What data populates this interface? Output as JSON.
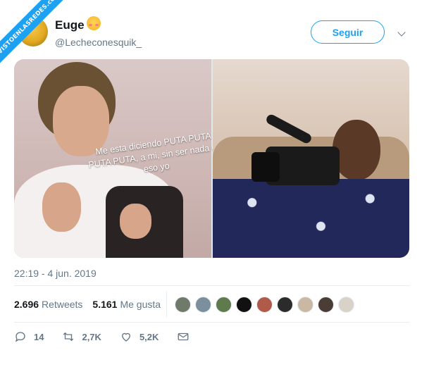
{
  "watermark": "VISTOENLASREDES.com",
  "tweet": {
    "display_name": "Euge",
    "handle": "@Lecheconesquik_",
    "follow_label": "Seguir",
    "meme_text": "Me esta diciendo PUTA PUTA PUTA PUTA, a mi, sin ser nada de eso yo",
    "timestamp": "22:19 - 4 jun. 2019"
  },
  "stats": {
    "retweets_count": "2.696",
    "retweets_label": "Retweets",
    "likes_count": "5.161",
    "likes_label": "Me gusta"
  },
  "likers": [
    {
      "color": "#6f7a6a"
    },
    {
      "color": "#7c8f9c"
    },
    {
      "color": "#5f7a4c"
    },
    {
      "color": "#111111"
    },
    {
      "color": "#b05a4a"
    },
    {
      "color": "#2b2b2b"
    },
    {
      "color": "#c9b9a4"
    },
    {
      "color": "#4a3d36"
    },
    {
      "color": "#d8d2c8"
    }
  ],
  "actions": {
    "reply_count": "14",
    "retweet_count": "2,7K",
    "like_count": "5,2K"
  },
  "colors": {
    "accent": "#1da1f2",
    "secondary_text": "#657786"
  }
}
